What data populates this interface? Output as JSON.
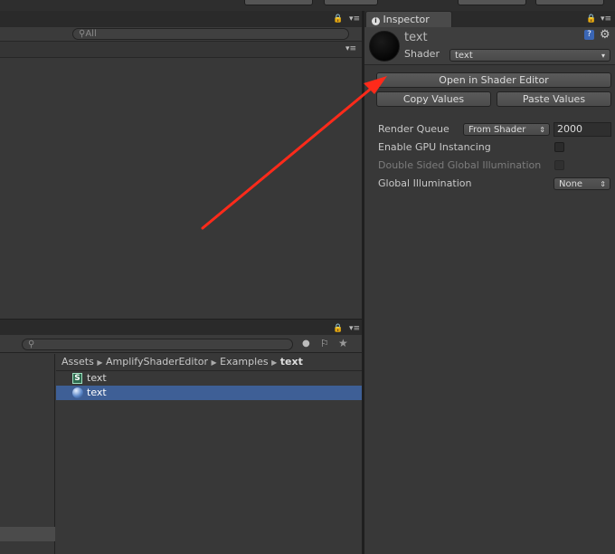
{
  "project": {
    "search_placeholder": "All"
  },
  "inspector": {
    "tab_label": "Inspector",
    "material_name": "text",
    "shader_label": "Shader",
    "shader_value": "text",
    "open_button": "Open in Shader Editor",
    "copy_button": "Copy Values",
    "paste_button": "Paste Values",
    "props": {
      "render_queue_label": "Render Queue",
      "render_queue_mode": "From Shader",
      "render_queue_value": "2000",
      "gpu_instancing_label": "Enable GPU Instancing",
      "double_sided_label": "Double Sided Global Illumination",
      "gi_label": "Global Illumination",
      "gi_value": "None"
    }
  },
  "browser": {
    "breadcrumb": [
      "Assets",
      "AmplifyShaderEditor",
      "Examples",
      "text"
    ],
    "items": [
      {
        "name": "text",
        "icon": "shader-file-icon"
      },
      {
        "name": "text",
        "icon": "material-sphere-icon"
      }
    ]
  },
  "colors": {
    "accent_selection": "#3e5f96",
    "annotation_arrow": "#ff2a1a"
  }
}
